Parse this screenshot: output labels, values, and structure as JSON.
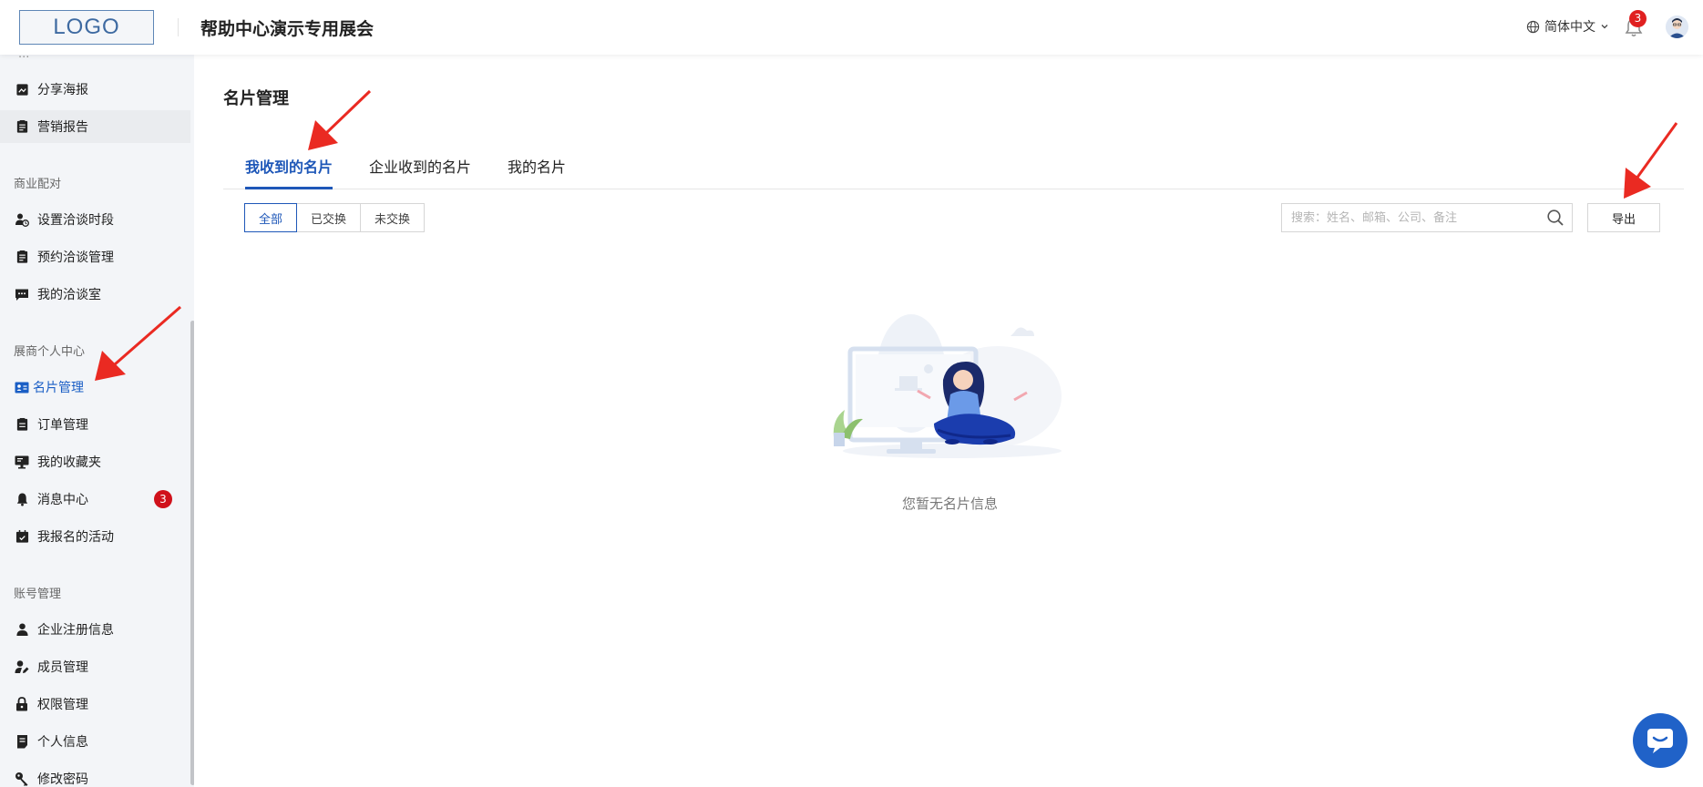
{
  "header": {
    "logo_text": "LOGO",
    "site_title": "帮助中心演示专用展会",
    "language": "简体中文",
    "notification_count": "3"
  },
  "sidebar": {
    "cut_label": "...",
    "items_top": [
      {
        "label": "分享海报",
        "icon": "poster-icon"
      },
      {
        "label": "营销报告",
        "icon": "report-icon"
      }
    ],
    "sections": [
      {
        "title": "商业配对",
        "items": [
          {
            "label": "设置洽谈时段",
            "icon": "user-clock-icon"
          },
          {
            "label": "预约洽谈管理",
            "icon": "clipboard-icon"
          },
          {
            "label": "我的洽谈室",
            "icon": "chat-icon"
          }
        ]
      },
      {
        "title": "展商个人中心",
        "items": [
          {
            "label": "名片管理",
            "icon": "id-card-icon",
            "active": true
          },
          {
            "label": "订单管理",
            "icon": "order-icon"
          },
          {
            "label": "我的收藏夹",
            "icon": "favorites-icon"
          },
          {
            "label": "消息中心",
            "icon": "bell-icon",
            "badge": "3"
          },
          {
            "label": "我报名的活动",
            "icon": "calendar-icon"
          }
        ]
      },
      {
        "title": "账号管理",
        "items": [
          {
            "label": "企业注册信息",
            "icon": "user-icon"
          },
          {
            "label": "成员管理",
            "icon": "user-edit-icon"
          },
          {
            "label": "权限管理",
            "icon": "lock-icon"
          },
          {
            "label": "个人信息",
            "icon": "document-icon"
          },
          {
            "label": "修改密码",
            "icon": "key-icon"
          }
        ]
      }
    ]
  },
  "main": {
    "page_title": "名片管理",
    "tabs": [
      {
        "label": "我收到的名片",
        "active": true
      },
      {
        "label": "企业收到的名片"
      },
      {
        "label": "我的名片"
      }
    ],
    "filters": [
      {
        "label": "全部",
        "active": true
      },
      {
        "label": "已交换"
      },
      {
        "label": "未交换"
      }
    ],
    "search_placeholder": "搜索：姓名、邮箱、公司、备注",
    "export_label": "导出",
    "empty_text": "您暂无名片信息"
  },
  "colors": {
    "accent": "#1e57b8",
    "badge": "#d0111b",
    "annotation_arrow": "#ea2a22",
    "sidebar_bg": "#f3f5f8"
  }
}
